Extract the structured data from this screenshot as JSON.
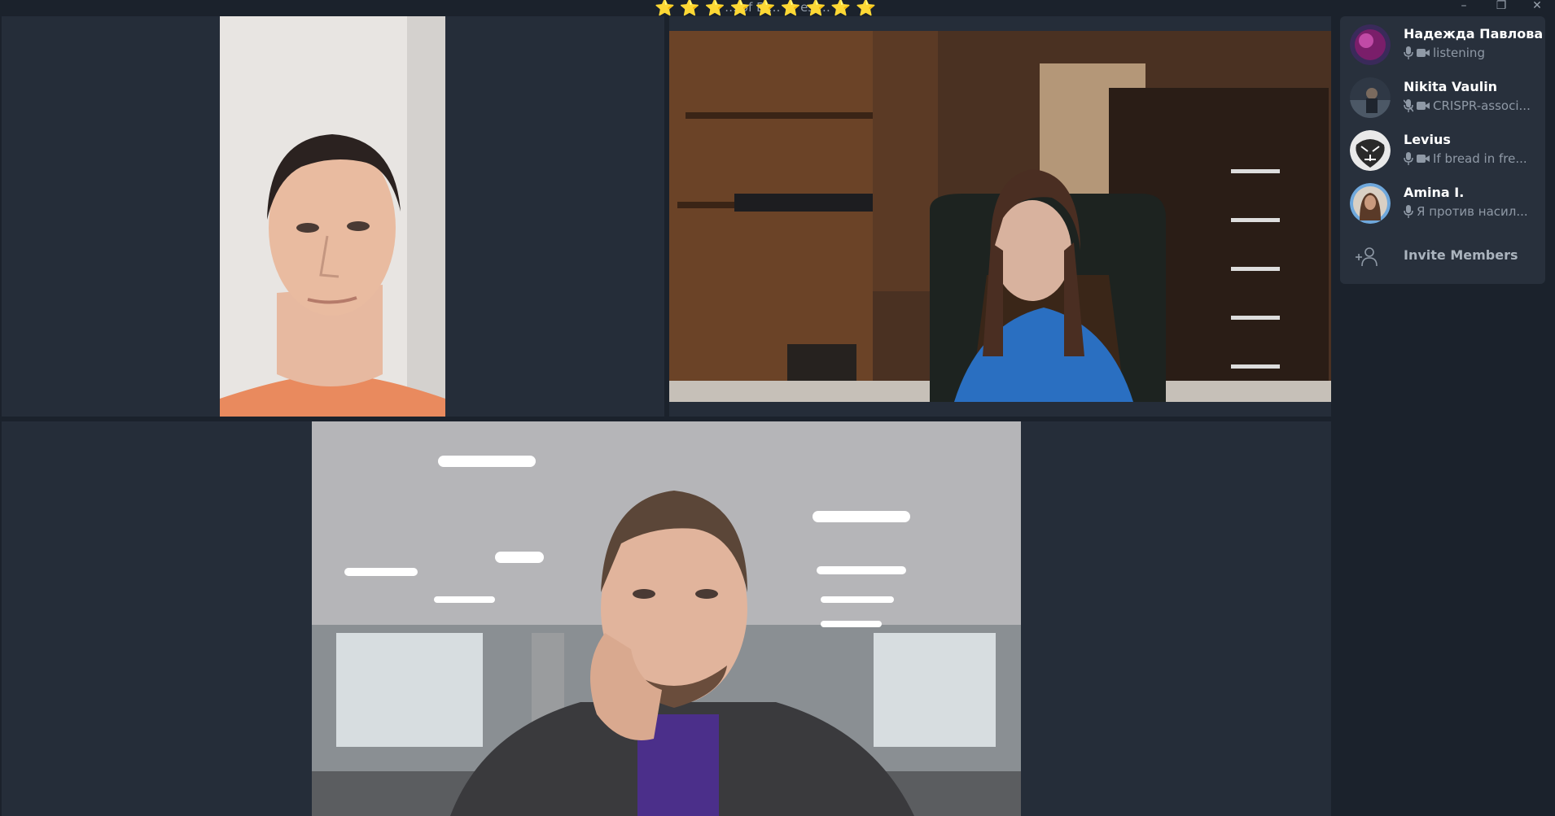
{
  "window": {
    "title": "… of Bi… … es …",
    "emoji": [
      "⭐",
      "⭐",
      "⭐",
      "⭐",
      "⭐",
      "⭐",
      "⭐",
      "⭐",
      "⭐"
    ],
    "controls": {
      "minimize": "–",
      "restore": "❐",
      "close": "✕"
    }
  },
  "participants": [
    {
      "name": "Надежда Павлова",
      "status": "listening",
      "mic": "on",
      "cam": "on",
      "avatar_icon": "avatar-purple"
    },
    {
      "name": "Nikita Vaulin",
      "status": "CRISPR-associ...",
      "mic": "muted",
      "cam": "on",
      "avatar_icon": "avatar-photo-dark"
    },
    {
      "name": "Levius",
      "status": "If bread in fre...",
      "mic": "on",
      "cam": "on",
      "avatar_icon": "avatar-tiger"
    },
    {
      "name": "Amina I.",
      "status": "Я против насил...",
      "mic": "on",
      "cam": "off",
      "avatar_icon": "avatar-photo-woman",
      "speaking": true
    }
  ],
  "invite": {
    "label": "Invite Members",
    "icon": "add-person-icon"
  },
  "colors": {
    "background": "#1b222c",
    "tile": "#252d39",
    "panel": "#28303c",
    "speaking_ring": "#6fa8dc"
  }
}
